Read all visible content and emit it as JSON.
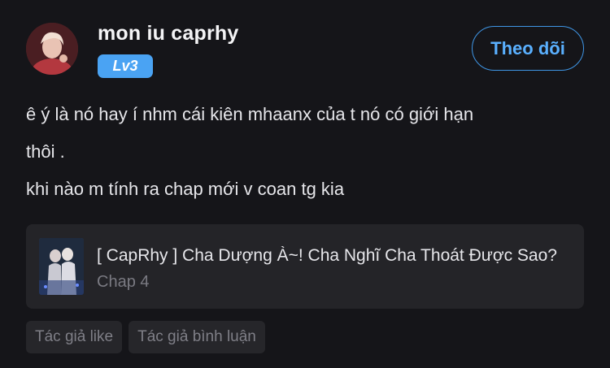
{
  "user": {
    "name": "mon iu caprhy",
    "level": "Lv3",
    "follow_label": "Theo dõi"
  },
  "comment": {
    "lines": [
      "ê ý là nó hay í nhm cái kiên mhaanx của t nó có giới hạn",
      "thôi .",
      "khi nào m tính ra chap mới v coan tg kia"
    ]
  },
  "linked_story": {
    "title": "[ CapRhy ] Cha Dượng À~! Cha Nghĩ Cha Thoát Được Sao?",
    "chapter": "Chap 4"
  },
  "tags": [
    "Tác giả like",
    "Tác giả bình luận"
  ],
  "colors": {
    "background": "#151519",
    "accent": "#4aa3f3",
    "card": "#242428"
  }
}
